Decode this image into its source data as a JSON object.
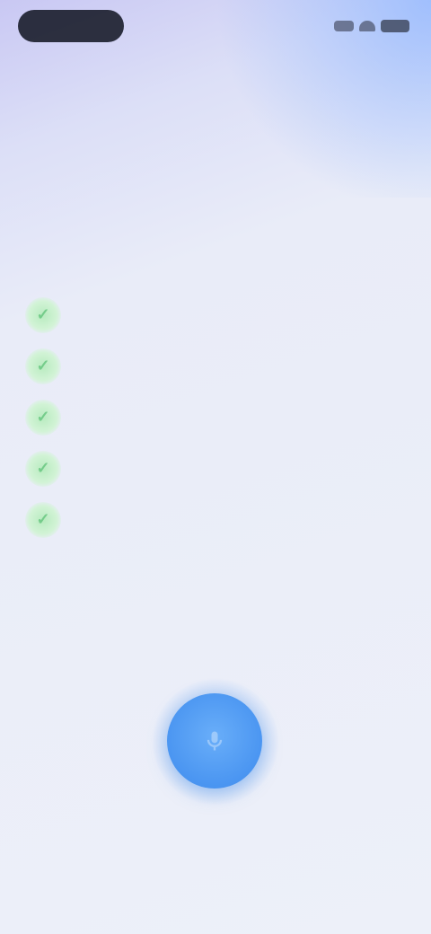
{
  "status_bar": {
    "pill": "",
    "icons": [
      "signal-icon",
      "wifi-icon",
      "battery-icon"
    ]
  },
  "app_title": "",
  "headline": "",
  "subhead": "",
  "features": [
    {
      "text": "",
      "icon": "check-icon"
    },
    {
      "text": "",
      "icon": "check-icon"
    },
    {
      "text": "",
      "icon": "check-icon"
    },
    {
      "text": "",
      "icon": "check-icon"
    },
    {
      "text": "",
      "icon": "check-icon"
    }
  ],
  "mic": {
    "icon": "microphone-icon",
    "label": "",
    "hint": ""
  },
  "colors": {
    "accent_blue": "#4a95f1",
    "check_green": "#b8ebbf",
    "background": "#edf0f9"
  }
}
